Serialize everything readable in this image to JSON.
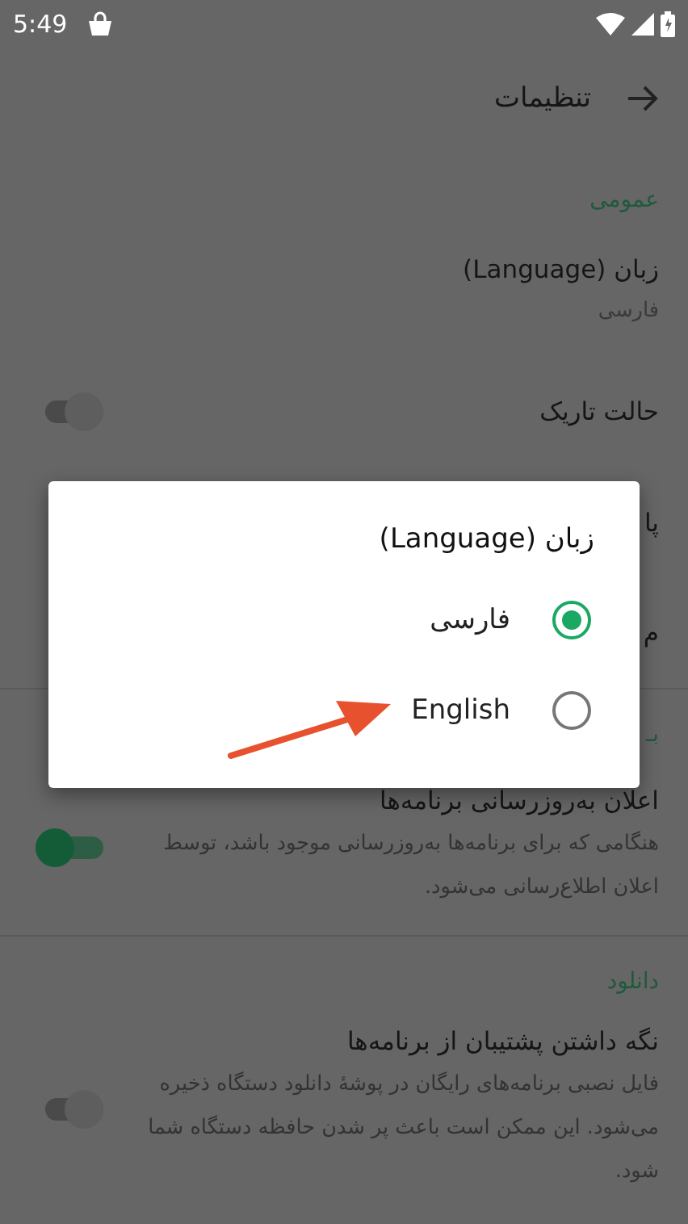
{
  "status_bar": {
    "time": "5:49"
  },
  "toolbar": {
    "title": "تنظیمات"
  },
  "sections": [
    {
      "header": "عمومی",
      "items": [
        {
          "kind": "value",
          "title": "زبان (Language)",
          "value": "فارسی"
        },
        {
          "kind": "switch",
          "title": "حالت تاریک",
          "on": false
        },
        {
          "kind": "plain",
          "title": "پا"
        },
        {
          "kind": "plain",
          "title": "م"
        }
      ]
    },
    {
      "header": "بـ",
      "items": [
        {
          "kind": "switch",
          "title": "اعلان به‌روزرسانی برنامه‌ها",
          "summary": "هنگامی که برای برنامه‌ها به‌روزرسانی موجود باشد، توسط اعلان اطلاع‌رسانی می‌شود.",
          "on": true
        }
      ]
    },
    {
      "header": "دانلود",
      "items": [
        {
          "kind": "switch",
          "title": "نگه داشتن پشتیبان از برنامه‌ها",
          "summary": "فایل نصبی برنامه‌های رایگان در پوشهٔ دانلود دستگاه ذخیره می‌شود. این ممکن است باعث پر شدن حافظه دستگاه شما شود.",
          "on": false
        }
      ]
    }
  ],
  "dialog": {
    "title": "زبان (Language)",
    "options": [
      {
        "label": "فارسی",
        "selected": true
      },
      {
        "label": "English",
        "selected": false
      }
    ]
  }
}
